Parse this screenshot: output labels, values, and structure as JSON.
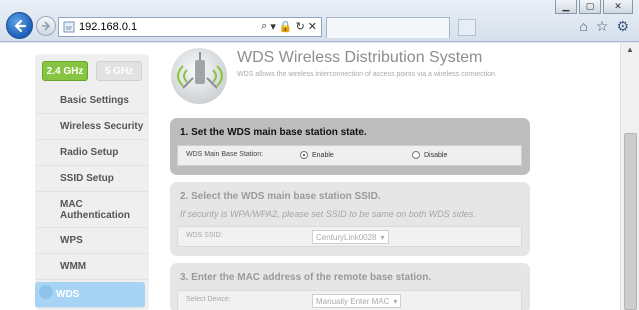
{
  "browser": {
    "address": "192.168.0.1",
    "addr_tools": [
      "⌕",
      "▾",
      "🔒",
      "↻",
      "✕"
    ],
    "window_controls": [
      "▁",
      "▢",
      "✕"
    ],
    "right_tools": [
      "⌂",
      "☆",
      "⚙"
    ]
  },
  "sidebar": {
    "bands": [
      "2.4 GHz",
      "5 GHz"
    ],
    "items": [
      {
        "label": "Basic Settings"
      },
      {
        "label": "Wireless Security"
      },
      {
        "label": "Radio Setup"
      },
      {
        "label": "SSID Setup"
      },
      {
        "label": "MAC Authentication"
      },
      {
        "label": "WPS"
      },
      {
        "label": "WMM"
      },
      {
        "label": "WDS",
        "active": true
      }
    ]
  },
  "header": {
    "title": "WDS Wireless Distribution System",
    "description": "WDS allows the wireless interconnection of access points via a wireless connection."
  },
  "section1": {
    "title": "1. Set the WDS main base station state.",
    "label": "WDS Main Base Station:",
    "enable": "Enable",
    "disable": "Disable",
    "selected": "Enable"
  },
  "section2": {
    "title": "2. Select the WDS main base station SSID.",
    "note": "If security is WPA/WPA2, please set SSID to be same on both WDS sides.",
    "label": "WDS SSID:",
    "value": "CenturyLink0028"
  },
  "section3": {
    "title": "3. Enter the MAC address of the remote base station.",
    "label": "Select Device:",
    "value": "Manually Enter MAC"
  },
  "colors": {
    "band_active": "#86c441",
    "menu_active": "#a7d4f5",
    "section_active": "#bdbdbd"
  }
}
